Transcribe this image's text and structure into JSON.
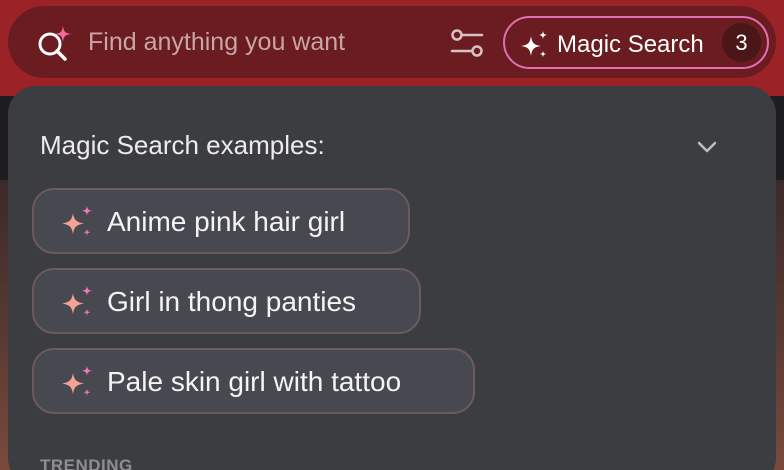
{
  "search": {
    "placeholder": "Find anything you want",
    "magic_label": "Magic Search",
    "magic_count": "3"
  },
  "panel": {
    "title": "Magic Search examples:",
    "examples": [
      {
        "label": "Anime pink hair girl"
      },
      {
        "label": "Girl in thong panties"
      },
      {
        "label": "Pale skin girl with tattoo"
      }
    ],
    "trending_label": "TRENDING"
  },
  "colors": {
    "header": "#9b2328",
    "searchbar": "#6a1c20",
    "panel": "#3c3d40",
    "accent_pink": "#f26a9c",
    "sparkle_peach": "#f7a293"
  },
  "icons": {
    "search": "magic-search-icon",
    "filter": "sliders-icon",
    "magic": "sparkles-icon",
    "collapse": "chevron-down-icon",
    "chip": "sparkles-icon"
  }
}
